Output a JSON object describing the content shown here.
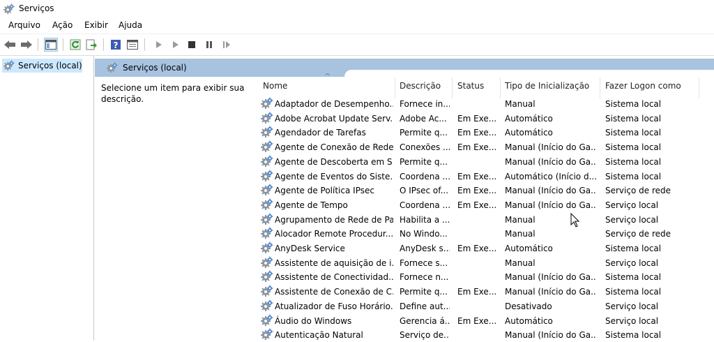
{
  "window": {
    "title": "Serviços"
  },
  "menu": [
    "Arquivo",
    "Ação",
    "Exibir",
    "Ajuda"
  ],
  "toolbar_icons": [
    "back-arrow-icon",
    "forward-arrow-icon",
    "show-console-tree-icon",
    "refresh-icon",
    "export-list-icon",
    "help-icon",
    "properties-icon",
    "start-service-icon",
    "start-service-alt-icon",
    "stop-service-icon",
    "pause-service-icon",
    "resume-service-icon"
  ],
  "tree": {
    "item": "Serviços (local)"
  },
  "band": {
    "title": "Serviços (local)"
  },
  "description_pane": {
    "text": "Selecione um item para exibir sua descrição."
  },
  "sort_indicator": "^",
  "columns": [
    "Nome",
    "Descrição",
    "Status",
    "Tipo de Inicialização",
    "Fazer Logon como"
  ],
  "rows": [
    {
      "name": "Adaptador de Desempenho...",
      "desc": "Fornece in...",
      "status": "",
      "start": "Manual",
      "logon": "Sistema local"
    },
    {
      "name": "Adobe Acrobat Update Serv...",
      "desc": "Adobe Ac...",
      "status": "Em Exe...",
      "start": "Automático",
      "logon": "Sistema local"
    },
    {
      "name": "Agendador de Tarefas",
      "desc": "Permite q...",
      "status": "Em Exe...",
      "start": "Automático",
      "logon": "Sistema local"
    },
    {
      "name": "Agente de Conexão de Rede",
      "desc": "Conexões ...",
      "status": "Em Exe...",
      "start": "Manual (Início do Ga...",
      "logon": "Sistema local"
    },
    {
      "name": "Agente de Descoberta em S...",
      "desc": "Permite q...",
      "status": "",
      "start": "Manual (Início do Ga...",
      "logon": "Sistema local"
    },
    {
      "name": "Agente de Eventos do Siste...",
      "desc": "Coordena ...",
      "status": "Em Exe...",
      "start": "Automático (Início d...",
      "logon": "Sistema local"
    },
    {
      "name": "Agente de Política IPsec",
      "desc": "O IPsec of...",
      "status": "Em Exe...",
      "start": "Manual (Início do Ga...",
      "logon": "Serviço de rede"
    },
    {
      "name": "Agente de Tempo",
      "desc": "Coordena ...",
      "status": "Em Exe...",
      "start": "Manual (Início do Ga...",
      "logon": "Serviço local"
    },
    {
      "name": "Agrupamento de Rede de Par",
      "desc": "Habilita a ...",
      "status": "",
      "start": "Manual",
      "logon": "Serviço local"
    },
    {
      "name": "Alocador Remote Procedur...",
      "desc": "No Windo...",
      "status": "",
      "start": "Manual",
      "logon": "Serviço de rede"
    },
    {
      "name": "AnyDesk Service",
      "desc": "AnyDesk s...",
      "status": "Em Exe...",
      "start": "Automático",
      "logon": "Sistema local"
    },
    {
      "name": "Assistente de aquisição de i...",
      "desc": "Fornece s...",
      "status": "",
      "start": "Manual",
      "logon": "Serviço local"
    },
    {
      "name": "Assistente de Conectividad...",
      "desc": "Fornece n...",
      "status": "",
      "start": "Manual (Início do Ga...",
      "logon": "Sistema local"
    },
    {
      "name": "Assistente de Conexão de C...",
      "desc": "Permite q...",
      "status": "Em Exe...",
      "start": "Manual (Início do Ga...",
      "logon": "Sistema local"
    },
    {
      "name": "Atualizador de Fuso Horário...",
      "desc": "Define aut...",
      "status": "",
      "start": "Desativado",
      "logon": "Serviço local"
    },
    {
      "name": "Áudio do Windows",
      "desc": "Gerencia á...",
      "status": "Em Exe...",
      "start": "Automático",
      "logon": "Serviço local"
    },
    {
      "name": "Autenticação Natural",
      "desc": "Serviço de...",
      "status": "",
      "start": "Manual (Início do Ga...",
      "logon": "Sistema local"
    }
  ]
}
